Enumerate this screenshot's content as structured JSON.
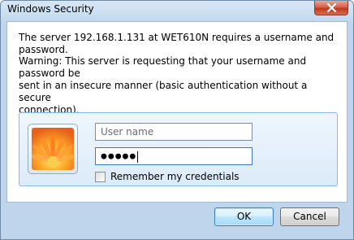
{
  "window": {
    "title": "Windows Security"
  },
  "message": {
    "server": "The server 192.168.1.131 at WET610N requires a username and password.",
    "warning": "Warning: This server is requesting that your username and password be\nsent in an insecure manner (basic authentication without a secure\nconnection)."
  },
  "credentials": {
    "username_placeholder": "User name",
    "username_value": "",
    "password_dots": "●●●●●",
    "remember_label": "Remember my credentials",
    "remember_checked": false,
    "avatar_icon": "flower-user-tile-icon"
  },
  "buttons": {
    "ok_label": "OK",
    "cancel_label": "Cancel"
  },
  "colors": {
    "title_bar": "#cde0f2",
    "panel_border": "#8fb8e0",
    "close_button": "#c0391f",
    "ok_button_border": "#3c7fb1"
  }
}
